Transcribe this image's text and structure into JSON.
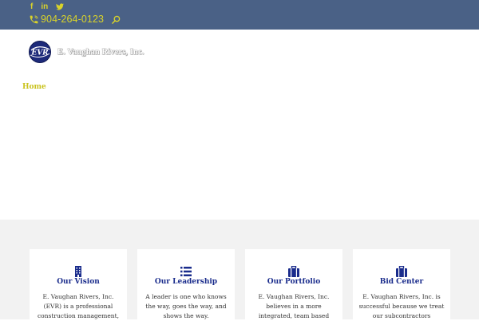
{
  "header": {
    "social": {
      "facebook_icon": "f",
      "linkedin_icon": "in",
      "twitter_icon": "t"
    },
    "phone": "904-264-0123",
    "search_icon": "search-icon"
  },
  "logo": {
    "emblem_text": "EVR",
    "company_name": "E. Vaughan Rivers, Inc."
  },
  "breadcrumb": {
    "home": "Home"
  },
  "cards": [
    {
      "icon": "building-icon",
      "title": "Our Vision",
      "text": "E. Vaughan Rivers, Inc. (EVR) is a professional construction management,"
    },
    {
      "icon": "list-icon",
      "title": "Our Leadership",
      "text": "A leader is one who knows the way, goes the way, and shows the way."
    },
    {
      "icon": "briefcase-icon",
      "title": "Our Portfolio",
      "text": "E. Vaughan Rivers, Inc. believes in a more integrated, team based"
    },
    {
      "icon": "briefcase-icon",
      "title": "Bid Center",
      "text": "E. Vaughan Rivers, Inc. is successful because we treat our subcontractors"
    }
  ],
  "colors": {
    "topbar": "#4a6186",
    "accent_yellow": "#d9d32a",
    "title_blue": "#1a2c8c",
    "section_gray": "#f2f2f2"
  }
}
